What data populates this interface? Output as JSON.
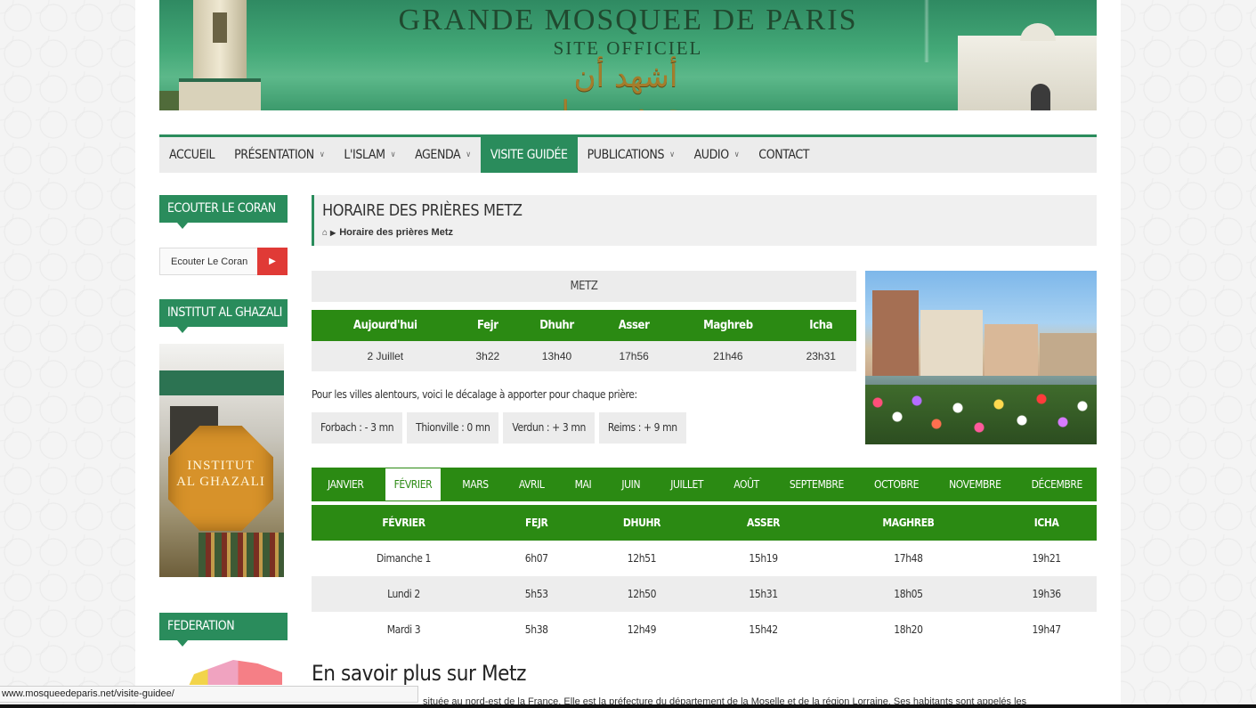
{
  "banner": {
    "title": "GRANDE MOSQUEE DE PARIS",
    "subtitle": "SITE OFFICIEL",
    "calligraphy": "أشهد أن محمد رسول الله"
  },
  "nav": [
    {
      "label": "ACCUEIL",
      "dropdown": false,
      "active": false
    },
    {
      "label": "PRÉSENTATION",
      "dropdown": true,
      "active": false
    },
    {
      "label": "L'ISLAM",
      "dropdown": true,
      "active": false
    },
    {
      "label": "AGENDA",
      "dropdown": true,
      "active": false
    },
    {
      "label": "VISITE GUIDÉE",
      "dropdown": false,
      "active": true
    },
    {
      "label": "PUBLICATIONS",
      "dropdown": true,
      "active": false
    },
    {
      "label": "AUDIO",
      "dropdown": true,
      "active": false
    },
    {
      "label": "CONTACT",
      "dropdown": false,
      "active": false
    }
  ],
  "sidebar": {
    "coran_heading": "ECOUTER LE CORAN",
    "coran_button_label": "Ecouter Le Coran",
    "coran_play_icon": "play-icon",
    "ghazali_heading": "INSTITUT AL GHAZALI",
    "ghazali_image_text_1": "INSTITUT",
    "ghazali_image_text_2": "AL GHAZALI",
    "federation_heading": "FEDERATION"
  },
  "page": {
    "title": "HORAIRE DES PRIÈRES METZ",
    "breadcrumb_icon": "home-icon",
    "breadcrumb": "Horaire des prières Metz"
  },
  "today": {
    "city": "METZ",
    "headers": [
      "Aujourd'hui",
      "Fejr",
      "Dhuhr",
      "Asser",
      "Maghreb",
      "Icha"
    ],
    "row": [
      "2 Juillet",
      "3h22",
      "13h40",
      "17h56",
      "21h46",
      "23h31"
    ]
  },
  "nearby": {
    "text": "Pour les villes alentours, voici le décalage à apporter pour chaque prière:",
    "chips": [
      "Forbach : - 3 mn",
      "Thionville : 0 mn",
      "Verdun : + 3 mn",
      "Reims : + 9 mn"
    ]
  },
  "months": [
    "JANVIER",
    "FÉVRIER",
    "MARS",
    "AVRIL",
    "MAI",
    "JUIN",
    "JUILLET",
    "AOÛT",
    "SEPTEMBRE",
    "OCTOBRE",
    "NOVEMBRE",
    "DÉCEMBRE"
  ],
  "active_month": "FÉVRIER",
  "monthly": {
    "headers": [
      "FÉVRIER",
      "FEJR",
      "DHUHR",
      "ASSER",
      "MAGHREB",
      "ICHA"
    ],
    "rows": [
      [
        "Dimanche 1",
        "6h07",
        "12h51",
        "15h19",
        "17h48",
        "19h21"
      ],
      [
        "Lundi 2",
        "5h53",
        "12h50",
        "15h31",
        "18h05",
        "19h36"
      ],
      [
        "Mardi 3",
        "5h38",
        "12h49",
        "15h42",
        "18h20",
        "19h47"
      ]
    ]
  },
  "more": {
    "title": "En savoir plus sur Metz",
    "text": "située au nord-est de la France. Elle est la préfecture du département de la Moselle et de la région Lorraine. Ses habitants sont appelés les"
  },
  "status_url": "www.mosqueedeparis.net/visite-guidee/",
  "colors": {
    "site_green": "#2a8c5c",
    "table_green": "#2b8a13",
    "play_red": "#e03a36"
  }
}
